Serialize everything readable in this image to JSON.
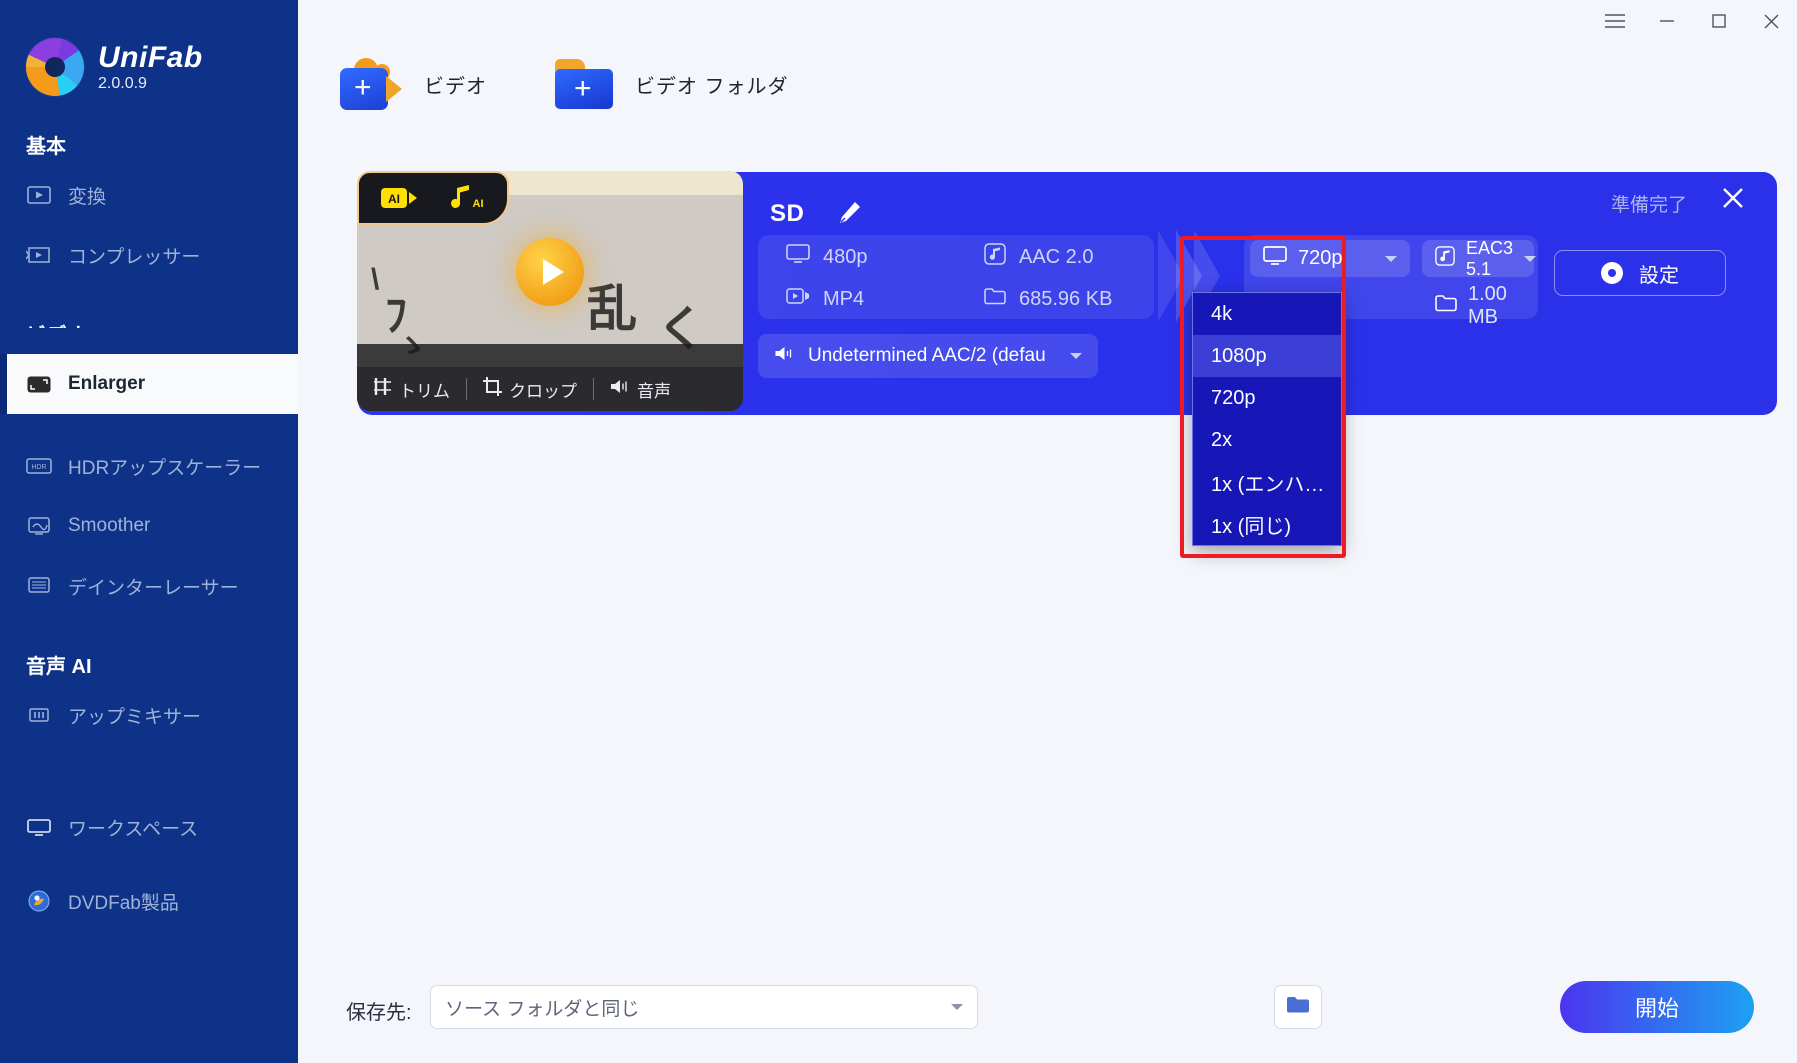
{
  "app": {
    "name": "UniFab",
    "version": "2.0.0.9"
  },
  "window_controls": {
    "menu": "menu-icon",
    "minimize": "–",
    "maximize": "❐",
    "close": "✕"
  },
  "sidebar": {
    "groups": [
      {
        "title": "基本",
        "items": [
          {
            "label": "変換",
            "icon": "convert-icon",
            "active": false
          },
          {
            "label": "コンプレッサー",
            "icon": "compressor-icon",
            "active": false
          }
        ]
      },
      {
        "title": "ビデオ AI",
        "items": [
          {
            "label": "Enlarger",
            "icon": "enlarger-icon",
            "active": true
          },
          {
            "label": "HDRアップスケーラー",
            "icon": "hdr-icon",
            "active": false
          },
          {
            "label": "Smoother",
            "icon": "smoother-icon",
            "active": false
          },
          {
            "label": "デインターレーサー",
            "icon": "deinterlacer-icon",
            "active": false
          }
        ]
      },
      {
        "title": "音声 AI",
        "items": [
          {
            "label": "アップミキサー",
            "icon": "upmixer-icon",
            "active": false
          }
        ]
      }
    ],
    "footer_items": [
      {
        "label": "ワークスペース",
        "icon": "workspace-icon"
      },
      {
        "label": "DVDFab製品",
        "icon": "dvdfab-icon"
      }
    ]
  },
  "toolbar": {
    "add_video_label": "ビデオ",
    "add_folder_label": "ビデオ フォルダ"
  },
  "task": {
    "status": "準備完了",
    "quality_label": "SD",
    "badges": [
      "ai-video-badge",
      "ai-audio-badge"
    ],
    "thumb_tools": [
      {
        "label": "トリム",
        "icon": "trim-icon"
      },
      {
        "label": "クロップ",
        "icon": "crop-icon"
      },
      {
        "label": "音声",
        "icon": "audio-icon"
      }
    ],
    "source": {
      "resolution": "480p",
      "audio": "AAC 2.0",
      "format": "MP4",
      "size": "685.96 KB"
    },
    "output": {
      "resolution": "720p",
      "audio": "EAC3 5.1",
      "size": "1.00 MB"
    },
    "audio_track": "Undetermined AAC/2 (defau",
    "settings_label": "設定"
  },
  "dropdown": {
    "open": true,
    "selected": "1080p",
    "options": [
      "4k",
      "1080p",
      "720p",
      "2x",
      "1x (エンハ…",
      "1x (同じ)"
    ],
    "highlight_color": "#ed1c24"
  },
  "bottom": {
    "save_label": "保存先:",
    "save_value": "ソース フォルダと同じ",
    "browse_icon": "folder-icon",
    "start_label": "開始"
  },
  "colors": {
    "sidebar_bg": "#0d3287",
    "card_bg": "#2b31e8",
    "accent": "#1da1f2",
    "highlight": "#ed1c24"
  }
}
